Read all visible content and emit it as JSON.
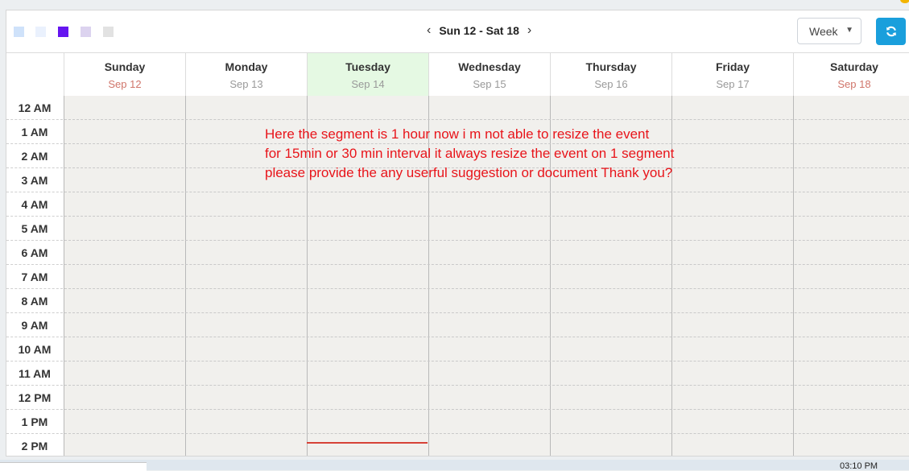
{
  "toolbar": {
    "swatches": [
      {
        "name": "swatch-light-blue",
        "color": "#cfe2fa"
      },
      {
        "name": "swatch-pale-blue",
        "color": "#eaf1fd"
      },
      {
        "name": "swatch-purple",
        "color": "#6515f0"
      },
      {
        "name": "swatch-lavender",
        "color": "#dcd3ef"
      },
      {
        "name": "swatch-gray",
        "color": "#e2e2e2"
      }
    ],
    "prev_icon": "chevron-left-icon",
    "next_icon": "chevron-right-icon",
    "prev_glyph": "‹",
    "next_glyph": "›",
    "range_label": "Sun 12 - Sat 18",
    "view_value": "Week",
    "view_caret": "▼",
    "refresh_icon": "refresh-icon",
    "accent_color": "#1a9fdc"
  },
  "days": [
    {
      "name": "Sunday",
      "date": "Sep 12",
      "weekend": true,
      "today": false
    },
    {
      "name": "Monday",
      "date": "Sep 13",
      "weekend": false,
      "today": false
    },
    {
      "name": "Tuesday",
      "date": "Sep 14",
      "weekend": false,
      "today": true
    },
    {
      "name": "Wednesday",
      "date": "Sep 15",
      "weekend": false,
      "today": false
    },
    {
      "name": "Thursday",
      "date": "Sep 16",
      "weekend": false,
      "today": false
    },
    {
      "name": "Friday",
      "date": "Sep 17",
      "weekend": false,
      "today": false
    },
    {
      "name": "Saturday",
      "date": "Sep 18",
      "weekend": true,
      "today": false
    }
  ],
  "times": [
    "12 AM",
    "1 AM",
    "2 AM",
    "3 AM",
    "4 AM",
    "5 AM",
    "6 AM",
    "7 AM",
    "8 AM",
    "9 AM",
    "10 AM",
    "11 AM",
    "12 PM",
    "1 PM",
    "2 PM"
  ],
  "annotation": {
    "text": "Here the segment is 1 hour now i m not able to resize the event\nfor 15min or 30 min interval it always resize the event on 1 segment\nplease provide the any userful suggestion or document Thank you?",
    "color": "#e8141a"
  },
  "taskbar": {
    "clock": "03:10 PM"
  }
}
